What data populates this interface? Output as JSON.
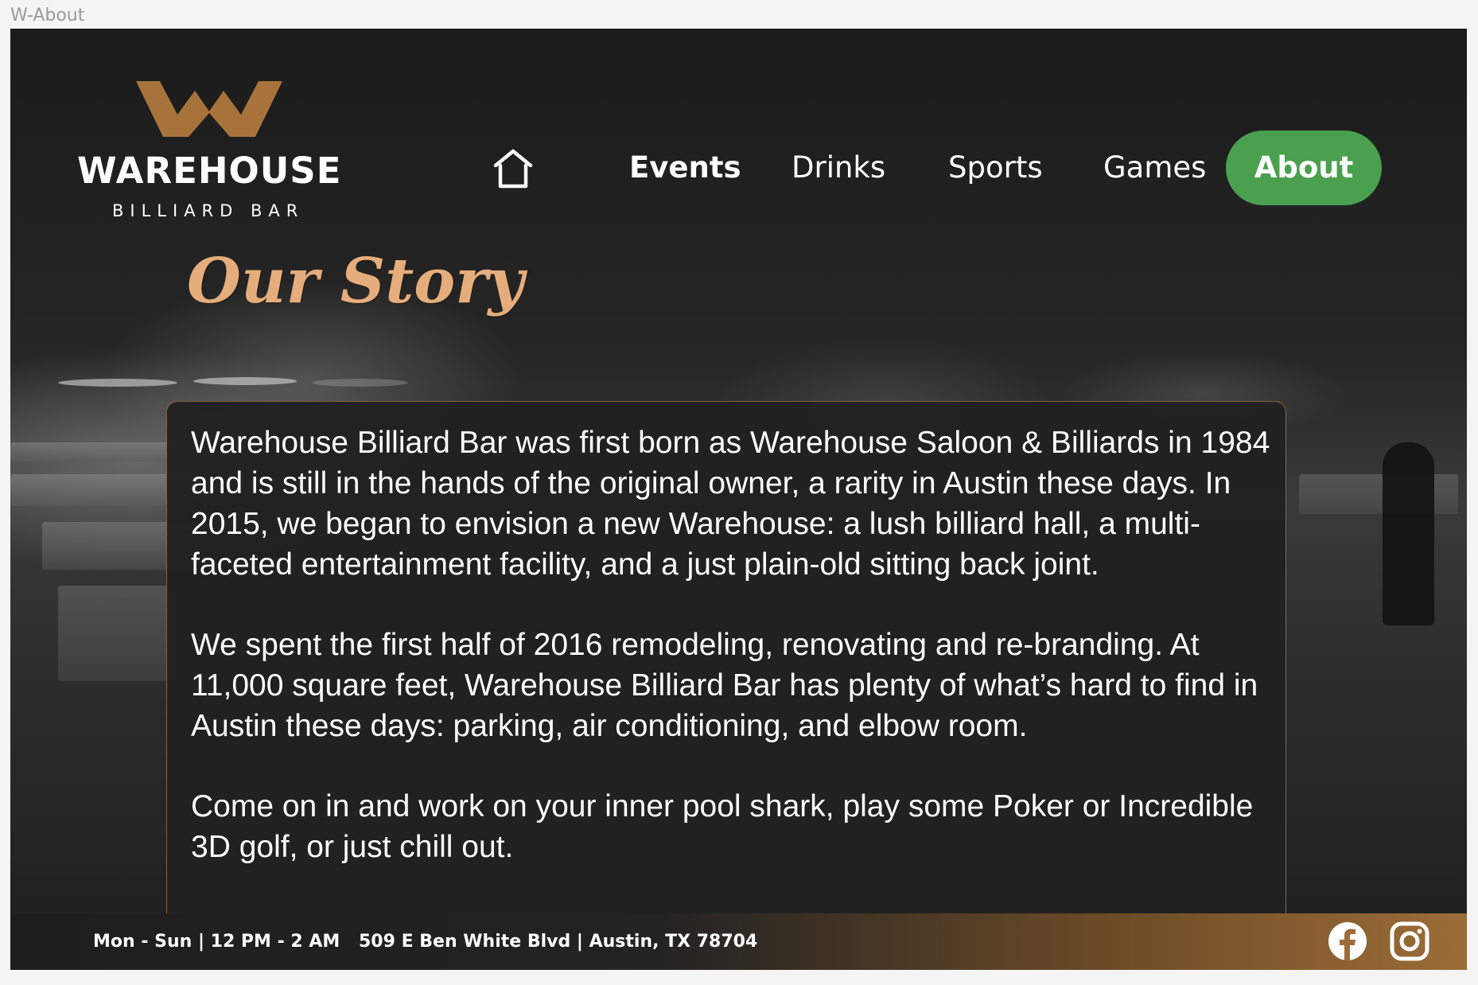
{
  "frame": {
    "label": "W-About"
  },
  "brand": {
    "name": "WAREHOUSE",
    "tagline": "BILLIARD BAR",
    "logo_icon": "crown-icon",
    "accent_color": "#a8733a"
  },
  "nav": {
    "home_icon": "home-icon",
    "items": [
      {
        "label": "Events",
        "active": false
      },
      {
        "label": "Drinks",
        "active": false
      },
      {
        "label": "Sports",
        "active": false
      },
      {
        "label": "Games",
        "active": false
      },
      {
        "label": "About",
        "active": true
      }
    ],
    "active_color": "#4aa04e"
  },
  "page": {
    "title": "Our Story",
    "title_color": "#e6ad7c",
    "paragraphs": [
      "Warehouse Billiard Bar was first born as Warehouse Saloon & Billiards in 1984 and is still in the hands of the original owner, a rarity in Austin these days. In 2015, we began to envision a new Warehouse: a lush billiard hall, a multi-faceted entertainment facility, and a just plain-old sitting back joint.",
      "We spent the first half of 2016 remodeling, renovating and re-branding. At 11,000 square feet, Warehouse Billiard Bar has plenty of what’s hard to find in Austin these days: parking, air conditioning, and elbow room.",
      "Come on in and work on your inner pool shark, play some Poker or Incredible 3D golf, or just chill out."
    ]
  },
  "footer": {
    "hours": "Mon - Sun | 12 PM - 2 AM",
    "address": "509 E Ben White Blvd | Austin, TX 78704",
    "social": [
      {
        "icon": "facebook-icon"
      },
      {
        "icon": "instagram-icon"
      }
    ]
  }
}
